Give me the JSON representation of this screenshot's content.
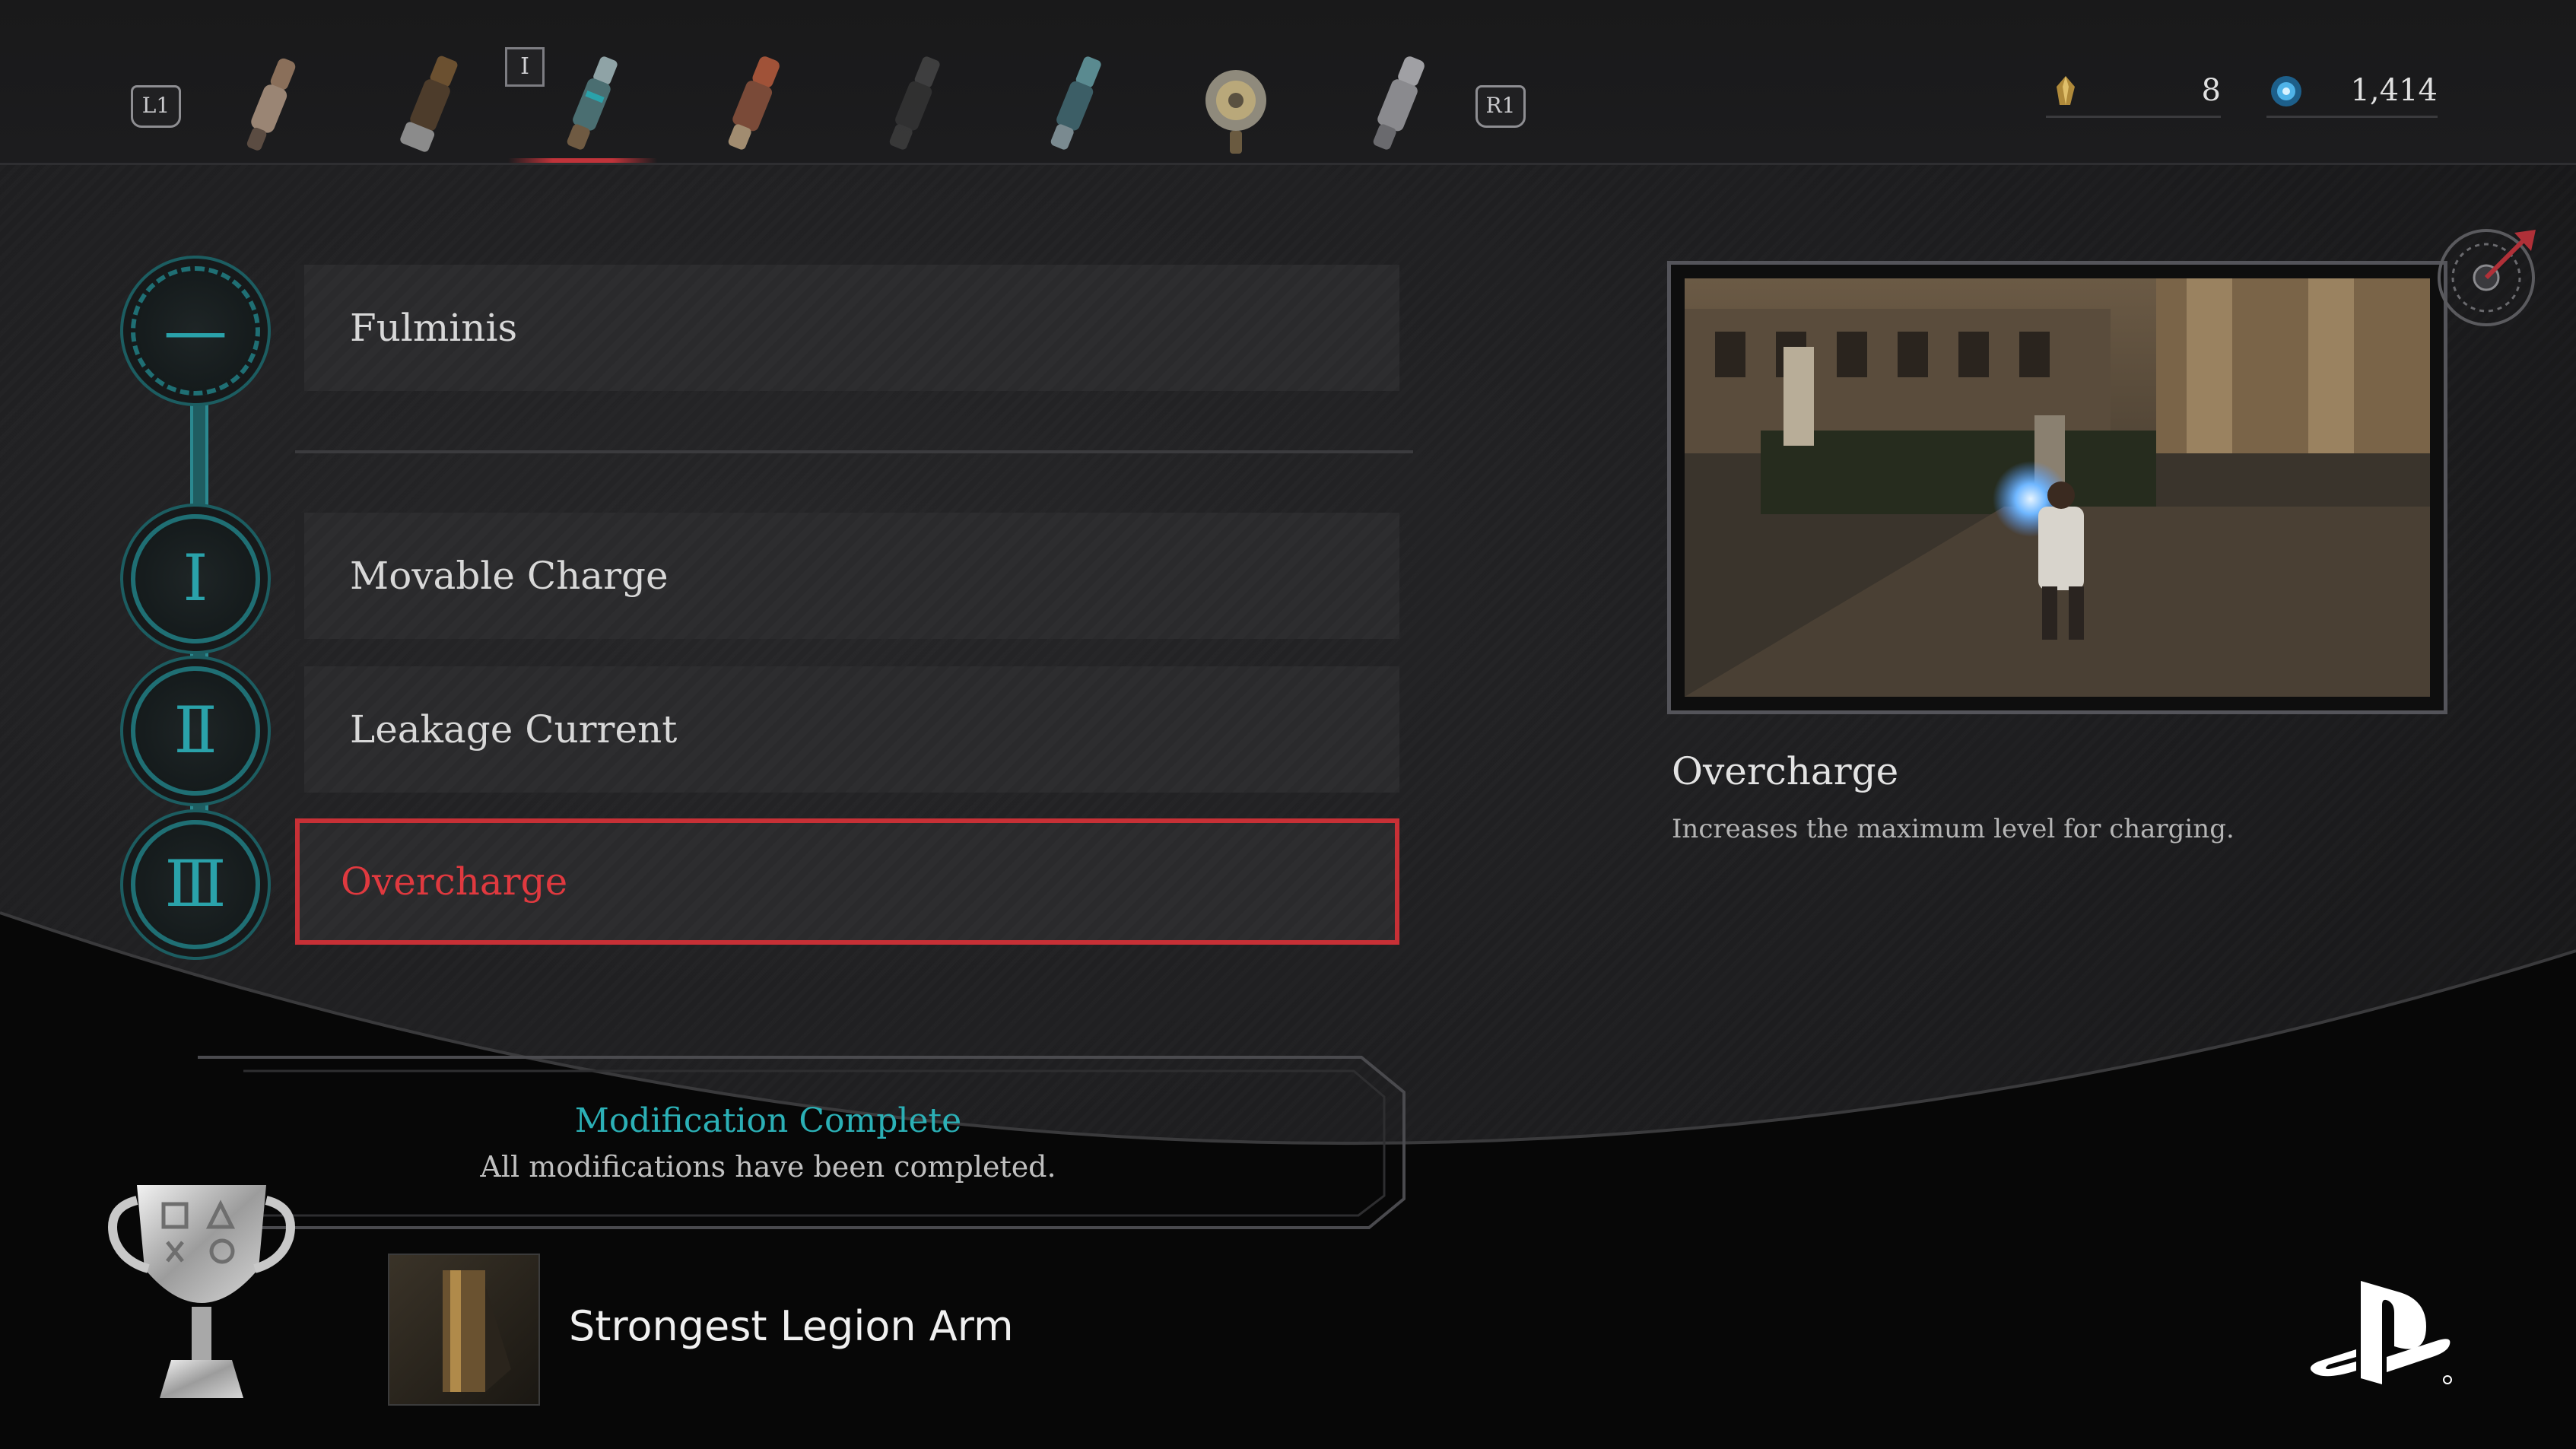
{
  "topbar": {
    "left_shoulder": "L1",
    "right_shoulder": "R1",
    "equipped_marker": "I",
    "arms": [
      {
        "icon": "legion-arm-1-icon"
      },
      {
        "icon": "legion-arm-2-icon"
      },
      {
        "icon": "legion-arm-3-icon",
        "selected": true
      },
      {
        "icon": "legion-arm-4-icon"
      },
      {
        "icon": "legion-arm-5-icon"
      },
      {
        "icon": "legion-arm-6-icon"
      },
      {
        "icon": "legion-arm-7-icon"
      },
      {
        "icon": "legion-arm-8-icon"
      }
    ],
    "currency_a": {
      "icon": "quartz-icon",
      "value": "8"
    },
    "currency_b": {
      "icon": "ergo-icon",
      "value": "1,414"
    }
  },
  "tree": {
    "root": {
      "label": "Fulminis",
      "node_glyph": "—"
    },
    "mods": [
      {
        "label": "Movable Charge",
        "node_glyph": "Ⅰ"
      },
      {
        "label": "Leakage Current",
        "node_glyph": "Ⅱ"
      },
      {
        "label": "Overcharge",
        "node_glyph": "Ⅲ",
        "selected": true
      }
    ]
  },
  "preview": {
    "title": "Overcharge",
    "description": "Increases the maximum level for charging."
  },
  "notice": {
    "title": "Modification Complete",
    "subtitle": "All modifications have been completed."
  },
  "trophy": {
    "name": "Strongest Legion Arm",
    "grade": "silver"
  },
  "colors": {
    "accent_teal": "#2bb0b6",
    "selected_red": "#c73036",
    "background": "#1d1d1f"
  }
}
